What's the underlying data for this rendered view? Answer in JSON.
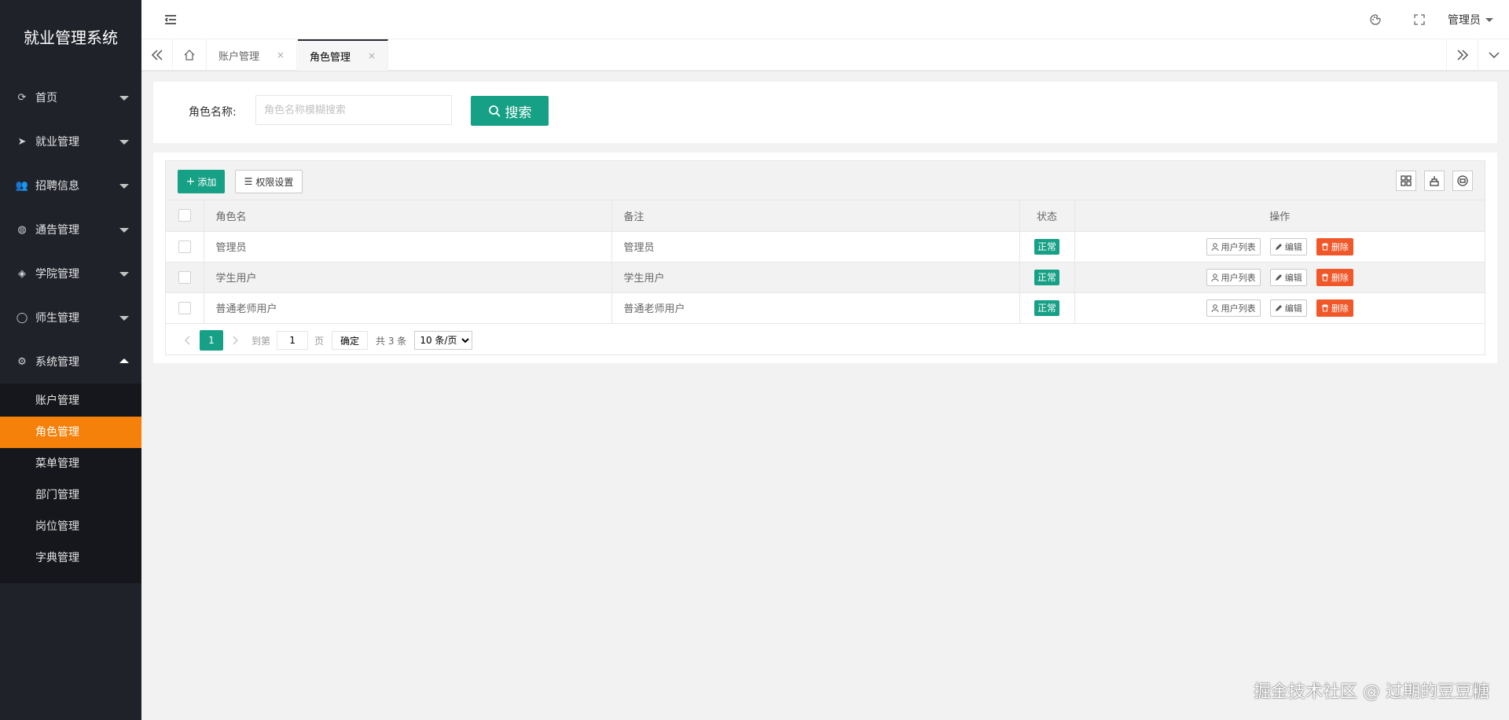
{
  "app": {
    "title": "就业管理系统"
  },
  "sidebar": {
    "items": [
      {
        "label": "首页",
        "icon": "home-icon",
        "glyph": "⟳"
      },
      {
        "label": "就业管理",
        "icon": "send-icon",
        "glyph": "➤"
      },
      {
        "label": "招聘信息",
        "icon": "users-icon",
        "glyph": "👥"
      },
      {
        "label": "通告管理",
        "icon": "globe-icon",
        "glyph": "◍"
      },
      {
        "label": "学院管理",
        "icon": "layers-icon",
        "glyph": "◈"
      },
      {
        "label": "师生管理",
        "icon": "user-icon",
        "glyph": "◯"
      },
      {
        "label": "系统管理",
        "icon": "gear-icon",
        "glyph": "⚙"
      }
    ],
    "sub_items": [
      {
        "label": "账户管理"
      },
      {
        "label": "角色管理"
      },
      {
        "label": "菜单管理"
      },
      {
        "label": "部门管理"
      },
      {
        "label": "岗位管理"
      },
      {
        "label": "字典管理"
      }
    ]
  },
  "header": {
    "user_label": "管理员"
  },
  "tabs": [
    {
      "label": "账户管理",
      "close": "×"
    },
    {
      "label": "角色管理",
      "close": "×"
    }
  ],
  "search": {
    "label": "角色名称:",
    "placeholder": "角色名称模糊搜索",
    "button_label": "搜索"
  },
  "toolbar": {
    "add_label": "添加",
    "perm_label": "权限设置"
  },
  "table": {
    "columns": [
      "角色名",
      "备注",
      "状态",
      "操作"
    ],
    "rows": [
      {
        "name": "管理员",
        "remark": "管理员",
        "status": "正常"
      },
      {
        "name": "学生用户",
        "remark": "学生用户",
        "status": "正常"
      },
      {
        "name": "普通老师用户",
        "remark": "普通老师用户",
        "status": "正常"
      }
    ],
    "ops": {
      "users": "用户列表",
      "edit": "编辑",
      "delete": "删除"
    }
  },
  "pager": {
    "current": "1",
    "goto_label": "到第",
    "page_value": "1",
    "page_unit": "页",
    "ok_label": "确定",
    "total": "共 3 条",
    "page_size": "10 条/页"
  },
  "watermark": "掘金技术社区 @ 过期的豆豆糖",
  "colors": {
    "sidebar_bg": "#20222a",
    "active_orange": "#f5800a",
    "primary_green": "#16a085",
    "danger": "#f0582a"
  }
}
